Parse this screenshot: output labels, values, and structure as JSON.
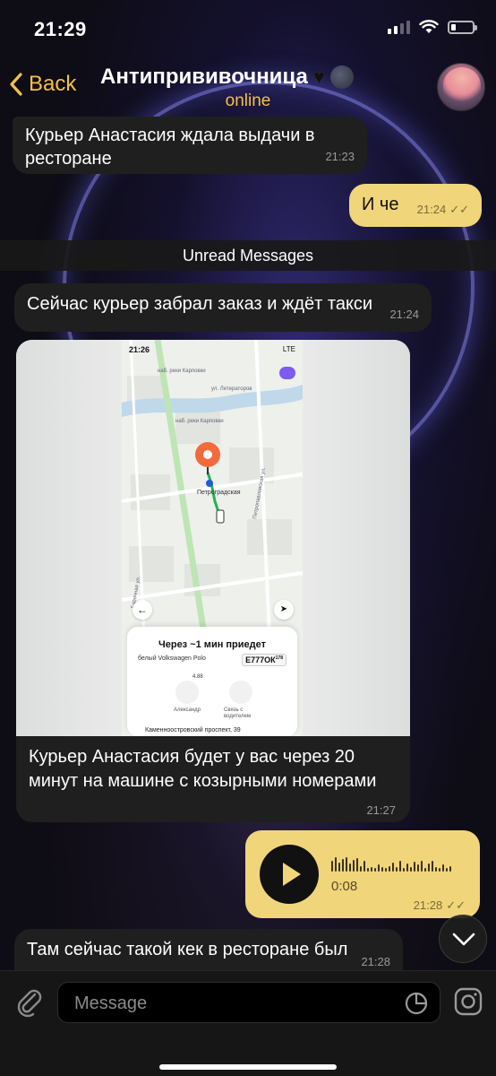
{
  "status_bar": {
    "time": "21:29",
    "signal_bars_filled": 2,
    "signal_bars_total": 4,
    "battery_level": 0.2
  },
  "header": {
    "back_label": "Back",
    "title": "Антипрививочница",
    "title_emoji": [
      "black-heart",
      "new-moon-face"
    ],
    "subtitle": "online",
    "accent_color": "#f3c14a"
  },
  "messages": [
    {
      "type": "incoming",
      "text": "Курьер Анастасия ждала выдачи в ресторане",
      "time": "21:23"
    },
    {
      "type": "outgoing",
      "text": "И че",
      "time": "21:24"
    },
    {
      "type": "incoming",
      "text": "Сейчас курьер забрал заказ и ждёт такси",
      "time": "21:24"
    },
    {
      "type": "incoming-photo",
      "caption": "Курьер Анастасия будет у вас через 20 минут на машине с козырными номерами",
      "time": "21:27",
      "screenshot": {
        "time": "21:26",
        "network": "LTE",
        "card_title": "Через ~1 мин приедет",
        "car": "белый Volkswagen Polo",
        "plate": "Е777ОК",
        "plate_region": "178",
        "rating": "4.88",
        "driver": "Александр",
        "call_label": "Связь с водителем",
        "address": "Каменноостровский проспект, 39",
        "station": "Петроградская",
        "streets": [
          "наб. реки Карповки",
          "ул. Литераторов",
          "наб. реки Карповки",
          "Петропавловская ул.",
          "Барочная ул."
        ]
      }
    },
    {
      "type": "outgoing-voice",
      "duration": "0:08",
      "time": "21:28"
    },
    {
      "type": "incoming",
      "text": "Там сейчас такой кек в ресторане был",
      "time": "21:28"
    }
  ],
  "unread_label": "Unread Messages",
  "input": {
    "placeholder": "Message"
  },
  "colors": {
    "outgoing_bubble": "#f0d57a",
    "incoming_bubble": "#1f1f1f"
  }
}
